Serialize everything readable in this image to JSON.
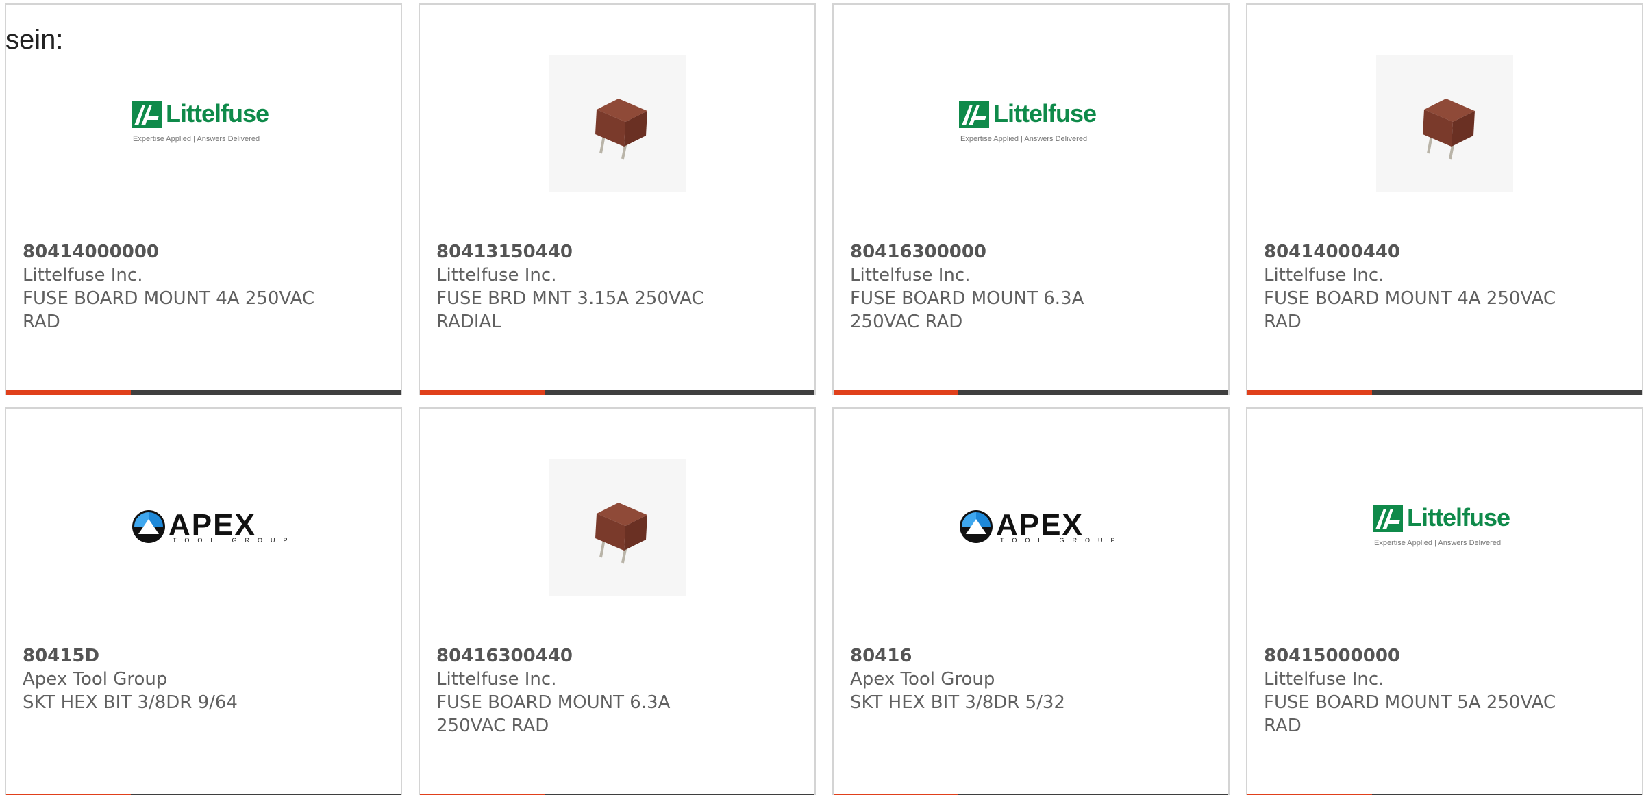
{
  "intro": {
    "text": "sein:"
  },
  "logos": {
    "littelfuse": {
      "word": "Littelfuse",
      "tagline": "Expertise Applied | Answers Delivered",
      "color": "#0f8a4a"
    },
    "apex": {
      "word": "APEX",
      "sub": "TOOL GROUP"
    }
  },
  "colors": {
    "accent_bar": "#e0401b",
    "dark_bar": "#3f3f3f",
    "card_border": "#d4d4d4"
  },
  "products": [
    {
      "part_number": "80414000000",
      "manufacturer": "Littelfuse Inc.",
      "description_line1": "FUSE BOARD MOUNT 4A 250VAC",
      "description_line2": "RAD",
      "image": "littelfuse-logo"
    },
    {
      "part_number": "80413150440",
      "manufacturer": "Littelfuse Inc.",
      "description_line1": "FUSE BRD MNT 3.15A 250VAC",
      "description_line2": "RADIAL",
      "image": "fuse-photo"
    },
    {
      "part_number": "80416300000",
      "manufacturer": "Littelfuse Inc.",
      "description_line1": "FUSE BOARD MOUNT 6.3A",
      "description_line2": "250VAC RAD",
      "image": "littelfuse-logo"
    },
    {
      "part_number": "80414000440",
      "manufacturer": "Littelfuse Inc.",
      "description_line1": "FUSE BOARD MOUNT 4A 250VAC",
      "description_line2": "RAD",
      "image": "fuse-photo"
    },
    {
      "part_number": "80415D",
      "manufacturer": "Apex Tool Group",
      "description_line1": "SKT HEX BIT 3/8DR 9/64",
      "description_line2": "",
      "image": "apex-logo"
    },
    {
      "part_number": "80416300440",
      "manufacturer": "Littelfuse Inc.",
      "description_line1": "FUSE BOARD MOUNT 6.3A",
      "description_line2": "250VAC RAD",
      "image": "fuse-photo"
    },
    {
      "part_number": "80416",
      "manufacturer": "Apex Tool Group",
      "description_line1": "SKT HEX BIT 3/8DR 5/32",
      "description_line2": "",
      "image": "apex-logo"
    },
    {
      "part_number": "80415000000",
      "manufacturer": "Littelfuse Inc.",
      "description_line1": "FUSE BOARD MOUNT 5A 250VAC",
      "description_line2": "RAD",
      "image": "littelfuse-logo"
    }
  ]
}
